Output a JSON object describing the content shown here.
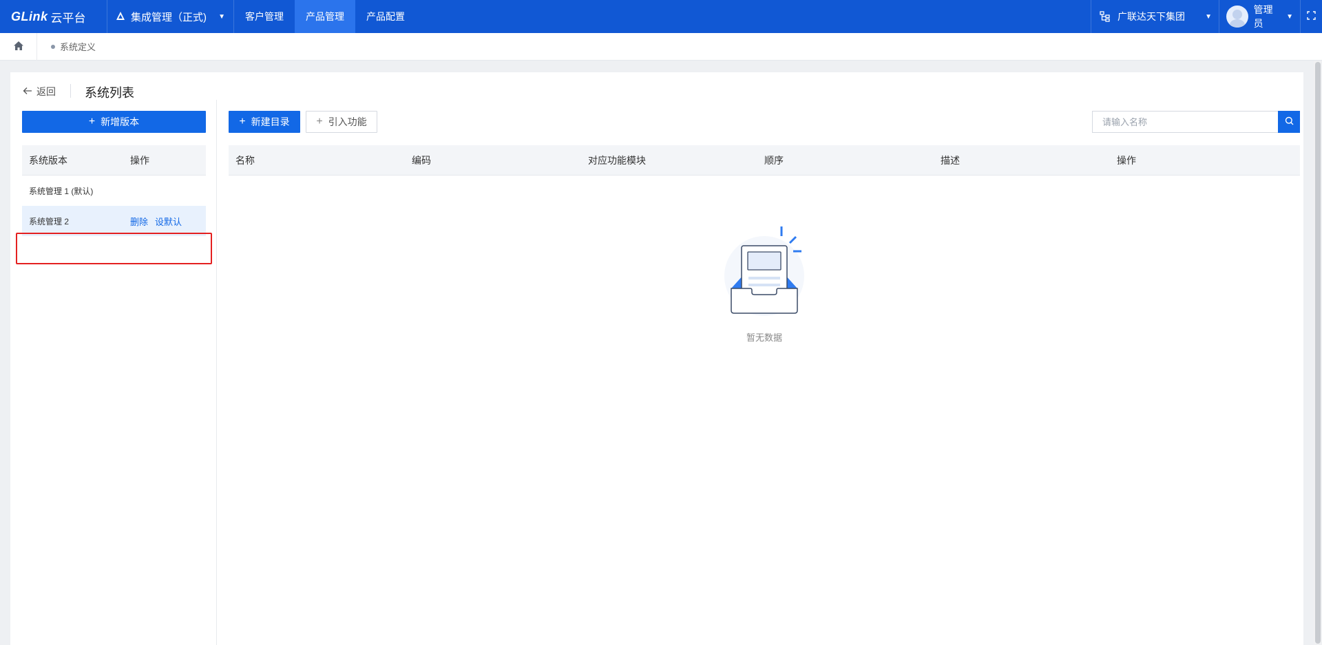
{
  "topbar": {
    "logo_brand": "GLink",
    "logo_suffix": "云平台",
    "env_label": "集成管理（正式)",
    "nav": [
      {
        "label": "客户管理",
        "active": false
      },
      {
        "label": "产品管理",
        "active": true
      },
      {
        "label": "产品配置",
        "active": false
      }
    ],
    "org_label": "广联达天下集团",
    "user_label": "管理员"
  },
  "breadcrumb": {
    "current": "系统定义"
  },
  "page": {
    "back_label": "返回",
    "title": "系统列表"
  },
  "left": {
    "add_button": "新增版本",
    "columns": [
      "系统版本",
      "操作"
    ],
    "rows": [
      {
        "name": "系统管理 1 (默认)",
        "actions": []
      },
      {
        "name": "系统管理 2",
        "actions": [
          "删除",
          "设默认"
        ],
        "selected": true
      }
    ]
  },
  "right": {
    "new_dir_button": "新建目录",
    "import_button": "引入功能",
    "search_placeholder": "请输入名称",
    "columns": [
      "名称",
      "编码",
      "对应功能模块",
      "顺序",
      "描述",
      "操作"
    ],
    "empty_text": "暂无数据"
  },
  "colors": {
    "topbar": "#1158d4",
    "nav_active": "#2b74ec",
    "primary": "#1268e6",
    "highlight": "#e42020",
    "selected_row": "#e8f1fd"
  }
}
